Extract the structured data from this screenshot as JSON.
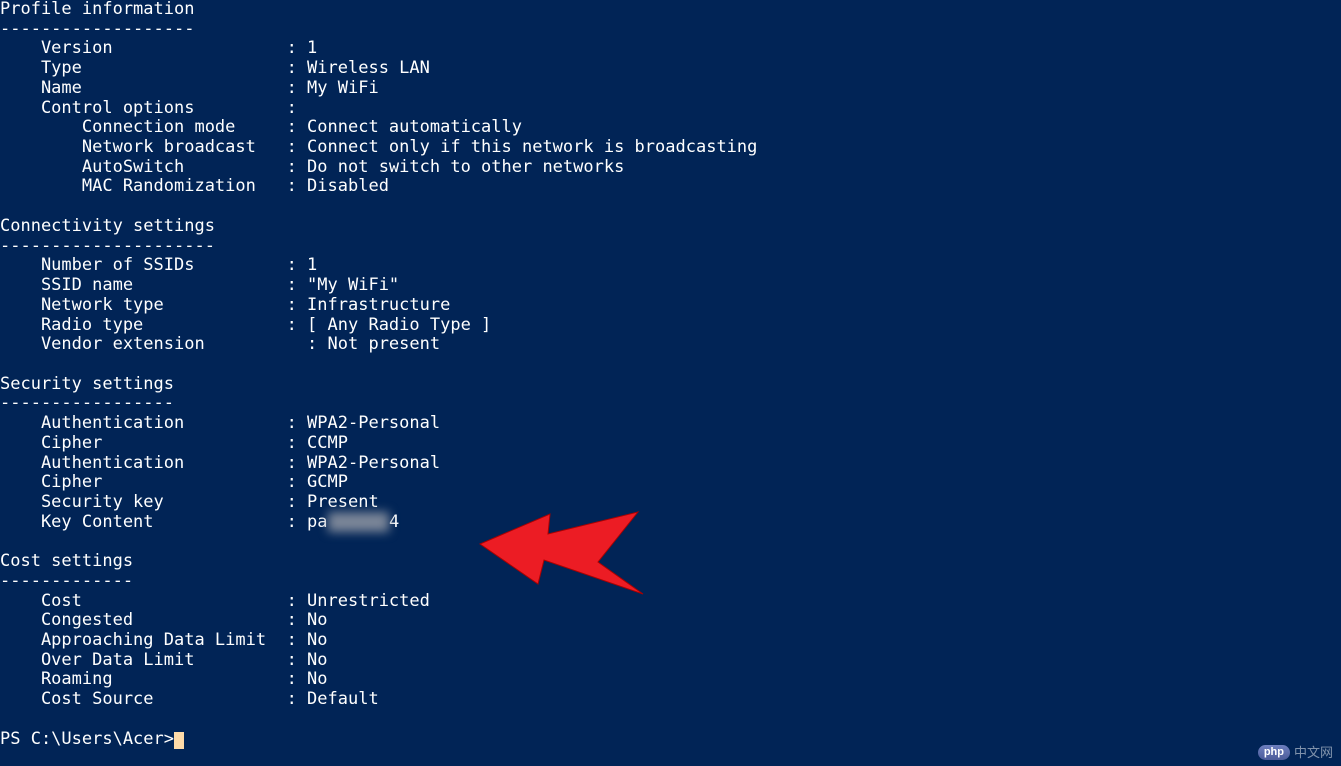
{
  "sections": {
    "profile": {
      "title": "Profile information",
      "underline": "-------------------",
      "rows": [
        {
          "label": "Version",
          "value": "1",
          "indent": 4
        },
        {
          "label": "Type",
          "value": "Wireless LAN",
          "indent": 4
        },
        {
          "label": "Name",
          "value": "My WiFi",
          "indent": 4
        },
        {
          "label": "Control options",
          "value": "",
          "indent": 4
        },
        {
          "label": "Connection mode",
          "value": "Connect automatically",
          "indent": 8
        },
        {
          "label": "Network broadcast",
          "value": "Connect only if this network is broadcasting",
          "indent": 8
        },
        {
          "label": "AutoSwitch",
          "value": "Do not switch to other networks",
          "indent": 8
        },
        {
          "label": "MAC Randomization",
          "value": "Disabled",
          "indent": 8
        }
      ]
    },
    "connectivity": {
      "title": "Connectivity settings",
      "underline": "---------------------",
      "rows": [
        {
          "label": "Number of SSIDs",
          "value": "1",
          "indent": 4
        },
        {
          "label": "SSID name",
          "value": "\"My WiFi\"",
          "indent": 4
        },
        {
          "label": "Network type",
          "value": "Infrastructure",
          "indent": 4
        },
        {
          "label": "Radio type",
          "value": "[ Any Radio Type ]",
          "indent": 4
        },
        {
          "label": "Vendor extension",
          "value": "Not present",
          "indent": 4,
          "vshift": true
        }
      ]
    },
    "security": {
      "title": "Security settings",
      "underline": "-----------------",
      "rows": [
        {
          "label": "Authentication",
          "value": "WPA2-Personal",
          "indent": 4
        },
        {
          "label": "Cipher",
          "value": "CCMP",
          "indent": 4
        },
        {
          "label": "Authentication",
          "value": "WPA2-Personal",
          "indent": 4
        },
        {
          "label": "Cipher",
          "value": "GCMP",
          "indent": 4
        },
        {
          "label": "Security key",
          "value": "Present",
          "indent": 4
        },
        {
          "label": "Key Content",
          "value_pre": "pa",
          "value_post": "4",
          "indent": 4,
          "blurred": true
        }
      ]
    },
    "cost": {
      "title": "Cost settings",
      "underline": "-------------",
      "rows": [
        {
          "label": "Cost",
          "value": "Unrestricted",
          "indent": 4
        },
        {
          "label": "Congested",
          "value": "No",
          "indent": 4
        },
        {
          "label": "Approaching Data Limit",
          "value": "No",
          "indent": 4
        },
        {
          "label": "Over Data Limit",
          "value": "No",
          "indent": 4
        },
        {
          "label": "Roaming",
          "value": "No",
          "indent": 4
        },
        {
          "label": "Cost Source",
          "value": "Default",
          "indent": 4
        }
      ]
    }
  },
  "prompt": "PS C:\\Users\\Acer>",
  "colon_col": 28,
  "value_col": 31,
  "watermark": {
    "badge": "php",
    "text": "中文网"
  }
}
